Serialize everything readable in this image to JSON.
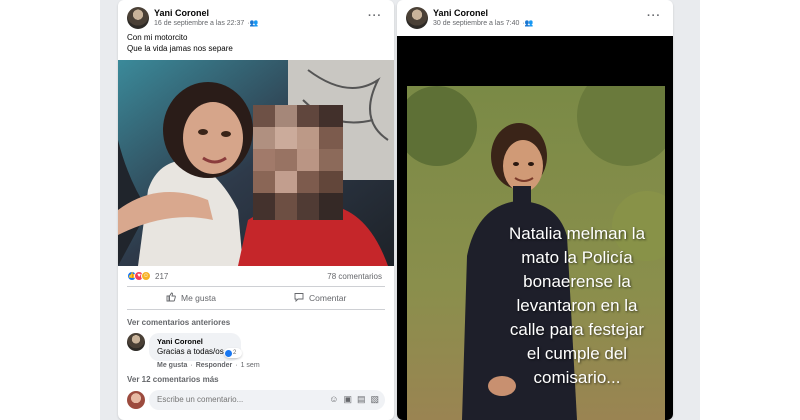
{
  "post1": {
    "author": "Yani Coronel",
    "date": "16 de septiembre a las 22:37",
    "text_line1": "Con mi motorcito",
    "text_line2": "Que la vida jamas nos separe",
    "reaction_count": "217",
    "comments_count": "78 comentarios",
    "like_label": "Me gusta",
    "comment_label": "Comentar",
    "previous_comments": "Ver comentarios anteriores",
    "comment": {
      "author": "Yani Coronel",
      "text": "Gracias a todas/os",
      "reaction_count": "2",
      "like": "Me gusta",
      "reply": "Responder",
      "time": "1 sem"
    },
    "more_comments": "Ver 12 comentarios más",
    "write_placeholder": "Escribe un comentario..."
  },
  "post2": {
    "author": "Yani Coronel",
    "date": "30 de septiembre a las 7:40",
    "overlay_text": "Natalia melman la\nmato la Policía\nbonaerense la\nlevantaron en la\ncalle para festejar\nel cumple del\ncomisario..."
  },
  "icons": {
    "friends": "friends-audience-icon",
    "menu": "more-options-icon",
    "like": "thumbs-up-icon",
    "comment": "comment-bubble-icon",
    "emoji": "emoji-icon",
    "camera": "camera-icon",
    "gif": "gif-icon",
    "sticker": "sticker-icon"
  },
  "colors": {
    "accent": "#1877f2",
    "muted_text": "#65676b",
    "background": "#e9ebee"
  }
}
